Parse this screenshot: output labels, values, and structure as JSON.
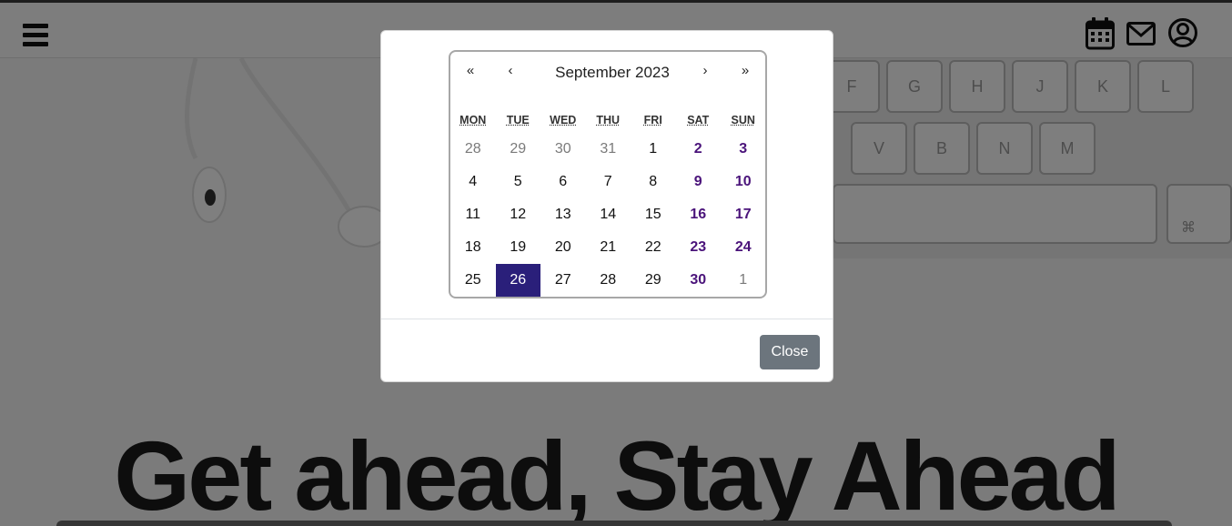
{
  "navbar": {
    "menu_icon": "hamburger-menu-icon",
    "calendar_icon": "calendar-icon",
    "mail_icon": "mail-icon",
    "profile_icon": "user-circle-icon"
  },
  "hero": {
    "headline": "Get ahead, Stay Ahead",
    "keyboard_keys_row1": [
      "F",
      "G",
      "H",
      "J",
      "K",
      "L"
    ],
    "keyboard_keys_row2": [
      "V",
      "B",
      "N",
      "M"
    ]
  },
  "modal": {
    "close_label": "Close"
  },
  "calendar": {
    "prev_year": "«",
    "prev_month": "‹",
    "next_month": "›",
    "next_year": "»",
    "month_label": "September 2023",
    "weekdays": [
      "MON",
      "TUE",
      "WED",
      "THU",
      "FRI",
      "SAT",
      "SUN"
    ],
    "weeks": [
      [
        "28",
        "29",
        "30",
        "31",
        "1",
        "2",
        "3"
      ],
      [
        "4",
        "5",
        "6",
        "7",
        "8",
        "9",
        "10"
      ],
      [
        "11",
        "12",
        "13",
        "14",
        "15",
        "16",
        "17"
      ],
      [
        "18",
        "19",
        "20",
        "21",
        "22",
        "23",
        "24"
      ],
      [
        "25",
        "26",
        "27",
        "28",
        "29",
        "30",
        "1"
      ]
    ],
    "other_month": [
      [
        true,
        true,
        true,
        true,
        false,
        false,
        false
      ],
      [
        false,
        false,
        false,
        false,
        false,
        false,
        false
      ],
      [
        false,
        false,
        false,
        false,
        false,
        false,
        false
      ],
      [
        false,
        false,
        false,
        false,
        false,
        false,
        false
      ],
      [
        false,
        false,
        false,
        false,
        false,
        false,
        true
      ]
    ],
    "selected_day": "26",
    "colors": {
      "selected_bg": "#2a1f7a",
      "weekend": "#4a137a",
      "other_month": "#7a7a7a"
    }
  }
}
